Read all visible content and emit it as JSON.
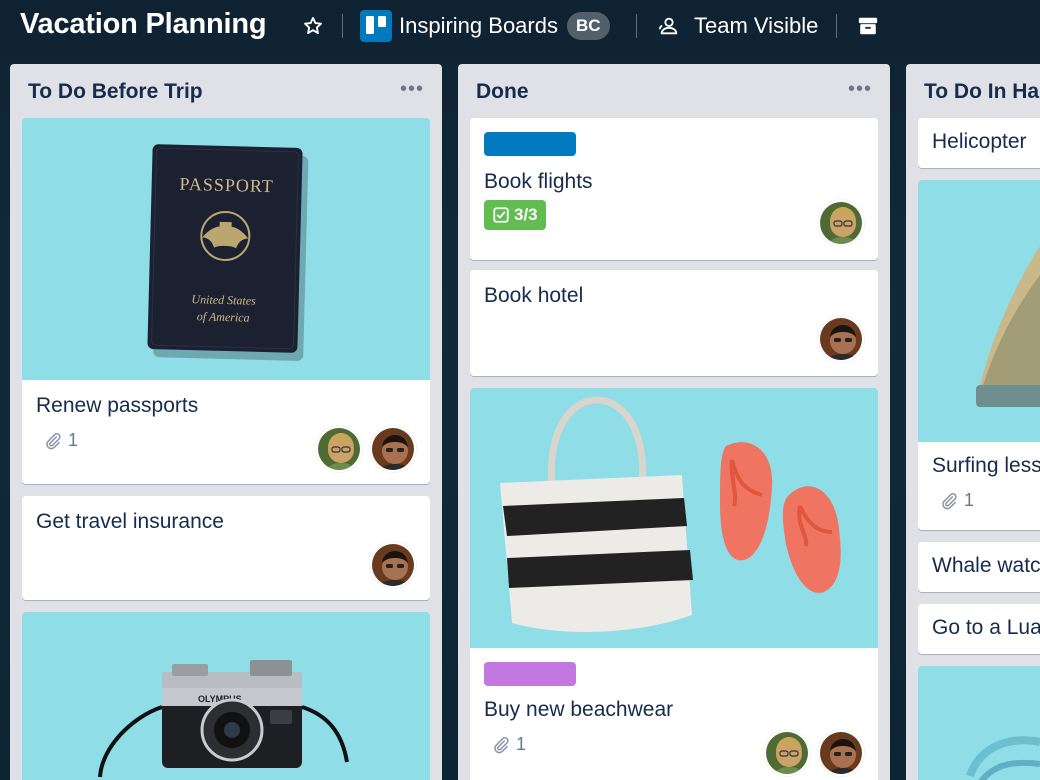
{
  "board": {
    "title": "Vacation Planning",
    "team_name": "Inspiring Boards",
    "team_badge": "BC",
    "visibility": "Team Visible"
  },
  "lists": [
    {
      "title": "To Do Before Trip",
      "cards": [
        {
          "title": "Renew passports",
          "cover": "passport",
          "attachments": "1",
          "members": [
            "woman-avatar",
            "man-avatar"
          ]
        },
        {
          "title": "Get travel insurance",
          "members": [
            "man-avatar"
          ]
        },
        {
          "title": "",
          "cover": "camera"
        }
      ]
    },
    {
      "title": "Done",
      "cards": [
        {
          "title": "Book flights",
          "label_color": "#0079bf",
          "checklist": "3/3",
          "members": [
            "woman-avatar"
          ]
        },
        {
          "title": "Book hotel",
          "members": [
            "man-avatar"
          ]
        },
        {
          "title": "Buy new beachwear",
          "cover": "tote-bag-and-sandals",
          "label_color": "#c377e0",
          "attachments": "1",
          "members": [
            "woman-avatar",
            "man-avatar"
          ]
        }
      ]
    },
    {
      "title": "To Do In Ha",
      "cards": [
        {
          "title": "Helicopter"
        },
        {
          "title": "Surfing less",
          "cover": "surfboard-fin",
          "attachments": "1"
        },
        {
          "title": "Whale watc"
        },
        {
          "title": "Go to a Lua"
        }
      ]
    }
  ],
  "colors": {
    "background": "#0e2232",
    "list_bg": "#dfe1e6",
    "cover_bg": "#8fdde6",
    "checklist_done": "#61bd4f"
  }
}
